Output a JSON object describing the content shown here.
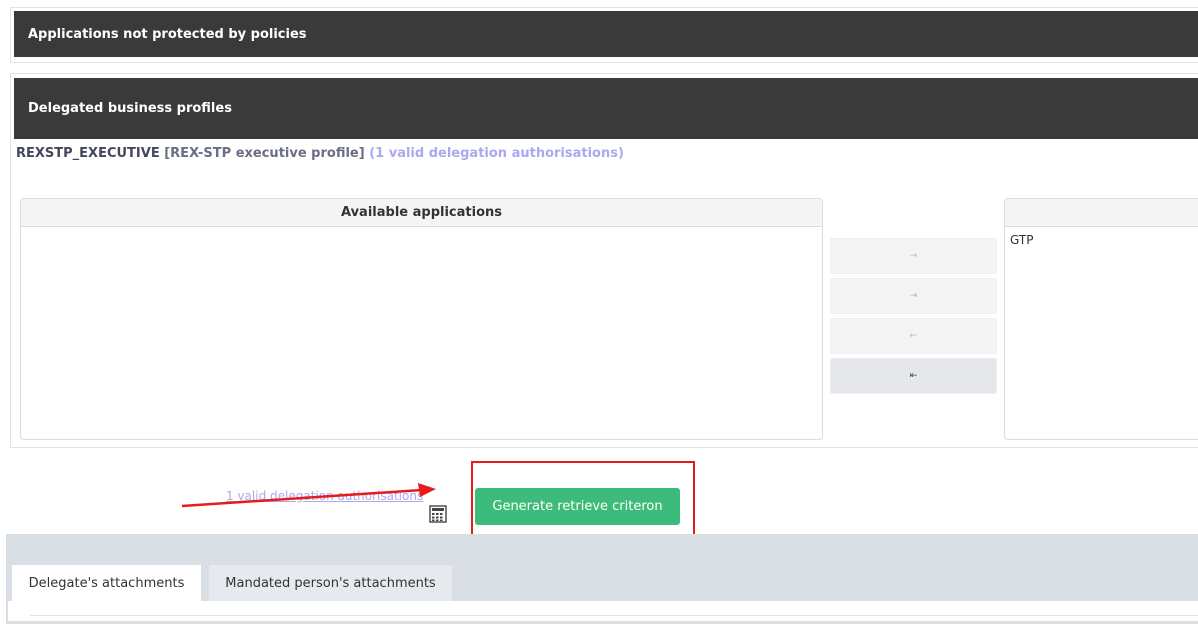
{
  "panels": {
    "unprotected_title": "Applications not protected by policies",
    "delegated_title": "Delegated business profiles"
  },
  "profile": {
    "code": "REXSTP_EXECUTIVE",
    "description": "[REX-STP executive profile]",
    "authorisations_link": "(1 valid delegation authorisations)"
  },
  "lists": {
    "available_header": "Available applications",
    "available_items": [],
    "selected_header": "",
    "selected_items": [
      "GTP"
    ]
  },
  "move_buttons": {
    "add": "→",
    "add_all": "⇥",
    "remove": "←",
    "remove_all": "⇤"
  },
  "actions": {
    "delegation_link": "1 valid delegation authorisations",
    "generate_button": "Generate retrieve criteron"
  },
  "tabs": [
    {
      "label": "Delegate's attachments",
      "active": true
    },
    {
      "label": "Mandated person's attachments",
      "active": false
    }
  ],
  "colors": {
    "header_bg": "#3a3a3a",
    "link": "#a9a9ee",
    "primary_button": "#3dbb7a",
    "annotation": "#e81b1b"
  },
  "icons": [
    "calculator-icon"
  ]
}
